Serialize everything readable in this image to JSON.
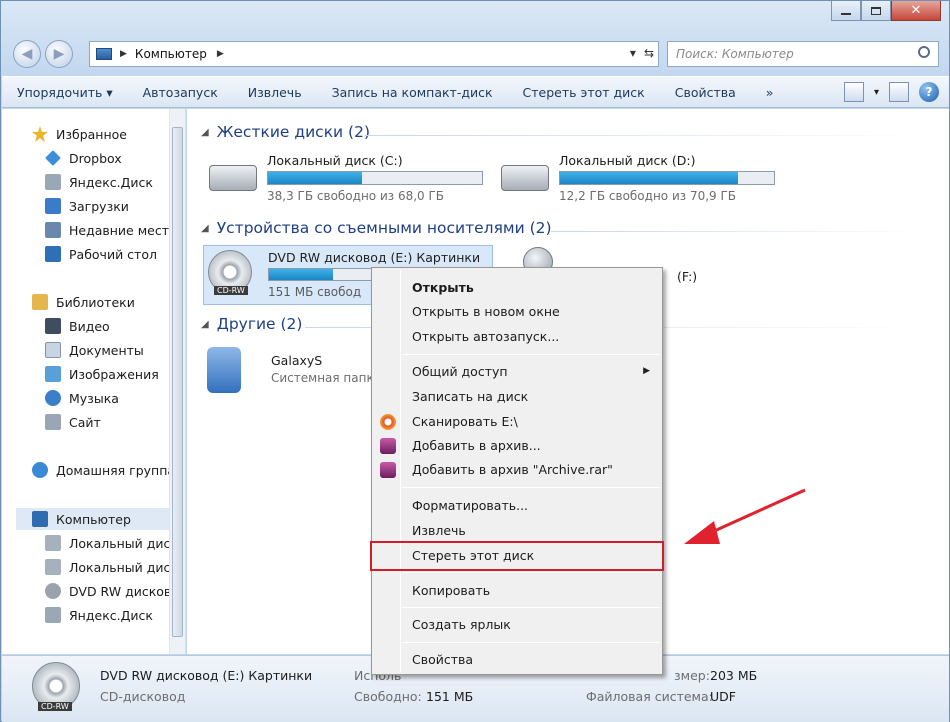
{
  "address": {
    "crumbs": [
      "Компьютер"
    ],
    "search_placeholder": "Поиск: Компьютер"
  },
  "toolbar": {
    "items": [
      "Упорядочить",
      "Автозапуск",
      "Извлечь",
      "Запись на компакт-диск",
      "Стереть этот диск",
      "Свойства"
    ],
    "more": "»"
  },
  "sidebar": {
    "items": [
      {
        "label": "Избранное",
        "icon": "star-icon",
        "color": "#e8b62a"
      },
      {
        "label": "Dropbox",
        "icon": "dropbox-icon",
        "color": "#3d8fdc"
      },
      {
        "label": "Яндекс.Диск",
        "icon": "yandex-disk-icon",
        "color": "#9aa7b4"
      },
      {
        "label": "Загрузки",
        "icon": "downloads-icon",
        "color": "#3a7cc8"
      },
      {
        "label": "Недавние места",
        "icon": "recent-places-icon",
        "color": "#6a88ad"
      },
      {
        "label": "Рабочий стол",
        "icon": "desktop-icon",
        "color": "#2f6fb5"
      },
      {
        "label": "Библиотеки",
        "icon": "libraries-icon",
        "color": "#e4b64b"
      },
      {
        "label": "Видео",
        "icon": "video-icon",
        "color": "#3f4d5e"
      },
      {
        "label": "Документы",
        "icon": "documents-icon",
        "color": "#c9d4e2"
      },
      {
        "label": "Изображения",
        "icon": "pictures-icon",
        "color": "#5aa0d8"
      },
      {
        "label": "Музыка",
        "icon": "music-icon",
        "color": "#3b7fc9"
      },
      {
        "label": "Сайт",
        "icon": "folder-icon",
        "color": "#9aa6b4"
      },
      {
        "label": "Домашняя группа",
        "icon": "homegroup-icon",
        "color": "#3a8ad3"
      },
      {
        "label": "Компьютер",
        "icon": "computer-icon",
        "color": "#2e6bb0"
      },
      {
        "label": "Локальный диск",
        "icon": "local-disk-icon",
        "color": "#a6b1bd"
      },
      {
        "label": "Локальный диск",
        "icon": "local-disk-icon",
        "color": "#a6b1bd"
      },
      {
        "label": "DVD RW дисковод",
        "icon": "dvd-icon",
        "color": "#9aa3ad"
      },
      {
        "label": "Яндекс.Диск",
        "icon": "yandex-disk-icon",
        "color": "#9aa7b4"
      }
    ]
  },
  "groups": {
    "hdd": "Жесткие диски (2)",
    "removable": "Устройства со съемными носителями (2)",
    "other": "Другие (2)"
  },
  "drives": {
    "c": {
      "name": "Локальный диск (C:)",
      "free": "38,3 ГБ свободно из 68,0 ГБ",
      "used_fraction": 0.44
    },
    "d": {
      "name": "Локальный диск (D:)",
      "free": "12,2 ГБ свободно из 70,9 ГБ",
      "used_fraction": 0.83
    },
    "e": {
      "name": "DVD RW дисковод (E:) Картинки",
      "free": "151 МБ свобод",
      "used_fraction": 0.3,
      "badge": "CD-RW"
    },
    "f": {
      "name": "(F:)"
    },
    "galaxy": {
      "name": "GalaxyS",
      "sub": "Системная папк"
    }
  },
  "context_menu": {
    "items": [
      {
        "label": "Открыть",
        "bold": true
      },
      {
        "label": "Открыть в новом окне"
      },
      {
        "label": "Открыть автозапуск..."
      },
      {
        "label": "Общий доступ",
        "submenu": true
      },
      {
        "label": "Записать на диск"
      },
      {
        "label": "Сканировать E:\\",
        "icon": "antivirus-icon",
        "color": "#e4542a"
      },
      {
        "label": "Добавить в архив...",
        "icon": "winrar-icon",
        "color": "#8a2d7a"
      },
      {
        "label": "Добавить в архив \"Archive.rar\"",
        "icon": "winrar-icon",
        "color": "#8a2d7a"
      },
      {
        "label": "Форматировать..."
      },
      {
        "label": "Извлечь"
      },
      {
        "label": "Стереть этот диск"
      },
      {
        "label": "Копировать"
      },
      {
        "label": "Создать ярлык"
      },
      {
        "label": "Свойства"
      }
    ]
  },
  "status": {
    "name": "DVD RW дисковод (E:) Картинки",
    "type": "CD-дисковод",
    "badge": "CD-RW",
    "used_label": "Исполь",
    "free_label": "Свободно:",
    "free_value": "151 МБ",
    "size_label": "змер:",
    "size_value": "203 МБ",
    "fs_label": "Файловая система:",
    "fs_value": "UDF"
  },
  "colors": {
    "accent": "#1e3f86",
    "highlight_border": "#d21d2b",
    "annotation_arrow": "#e0222f"
  }
}
